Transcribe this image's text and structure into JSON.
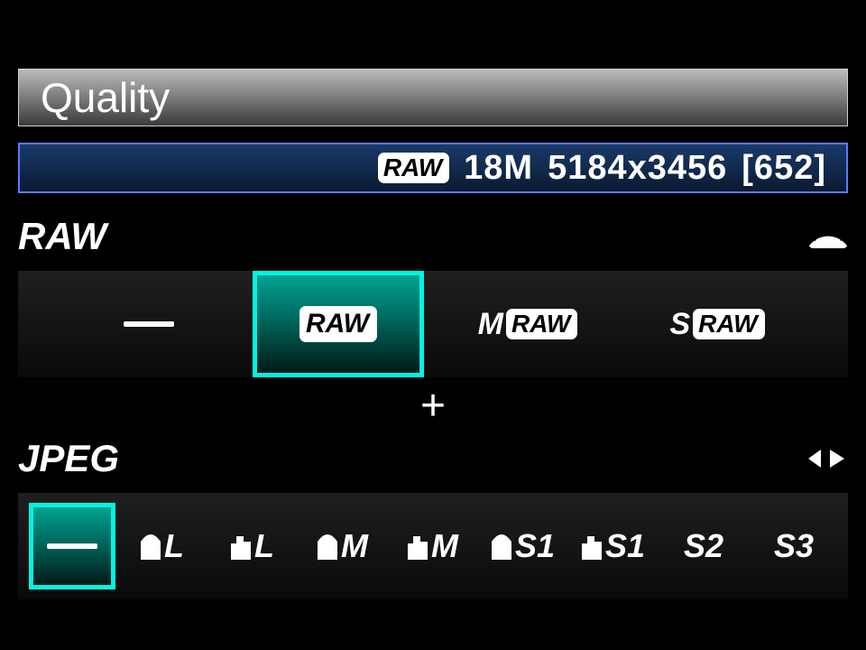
{
  "title": "Quality",
  "info": {
    "badge": "RAW",
    "megapixels": "18M",
    "dimensions": "5184x3456",
    "shots_remaining": "[652]"
  },
  "sections": {
    "raw": {
      "label": "RAW"
    },
    "jpeg": {
      "label": "JPEG"
    }
  },
  "separator": "+",
  "raw_options": {
    "none": "-",
    "raw": "RAW",
    "mraw_prefix": "M",
    "mraw_badge": "RAW",
    "sraw_prefix": "S",
    "sraw_badge": "RAW",
    "selected": "raw"
  },
  "jpeg_options": {
    "none": "-",
    "l_fine": "L",
    "l_normal": "L",
    "m_fine": "M",
    "m_normal": "M",
    "s1_fine": "S1",
    "s1_normal": "S1",
    "s2": "S2",
    "s3": "S3",
    "selected": "none"
  }
}
